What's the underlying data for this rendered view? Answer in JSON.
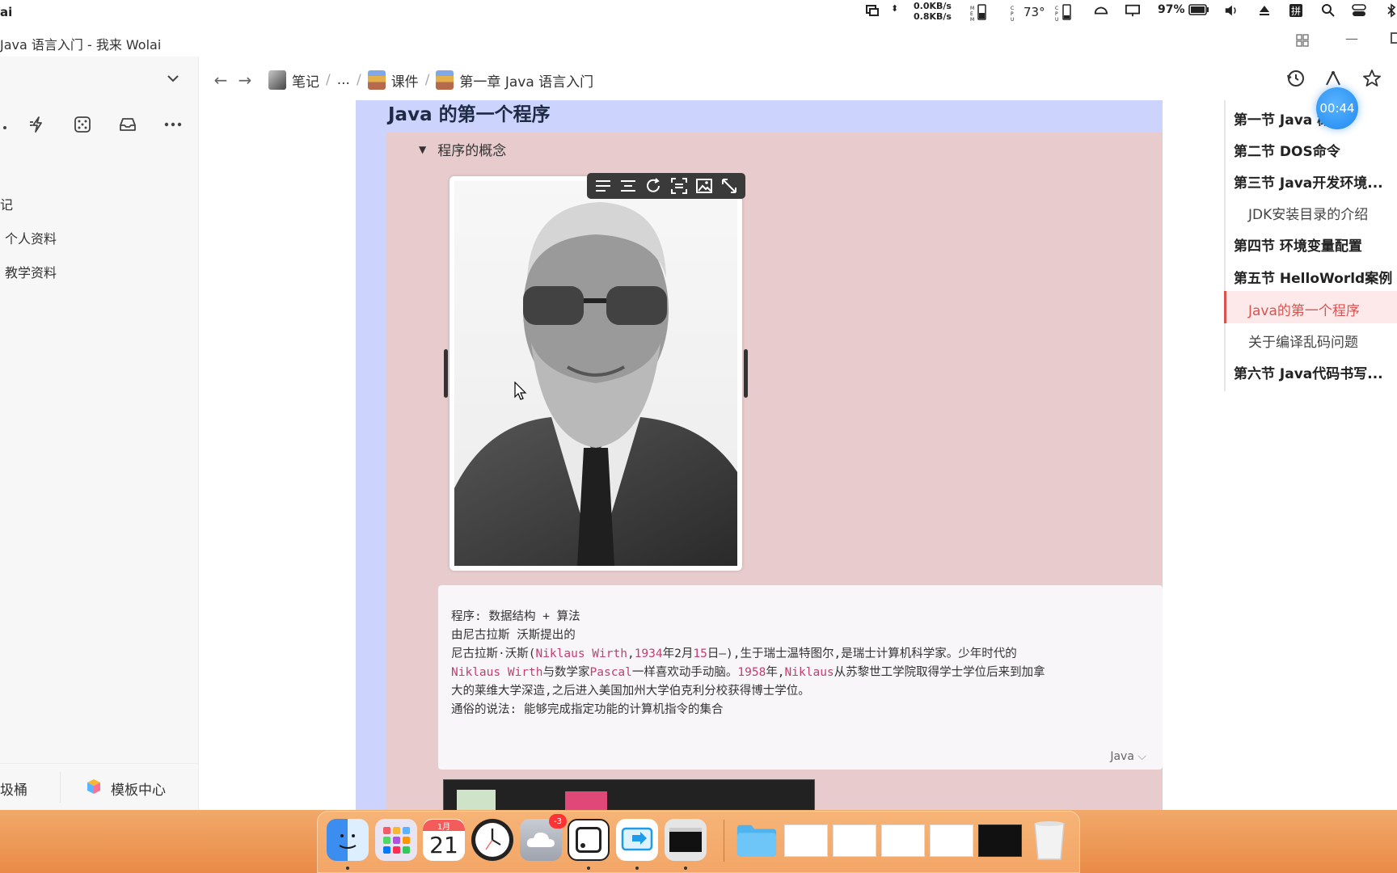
{
  "menubar": {
    "app_name": "ai",
    "net_up": "0.0KB/s",
    "net_down": "0.8KB/s",
    "temp": "73°",
    "battery": "97%"
  },
  "window": {
    "title": "Java 语言入门 - 我来 Wolai"
  },
  "sidebar": {
    "items": [
      {
        "label": "记"
      },
      {
        "label": "个人资料"
      },
      {
        "label": "教学资料"
      }
    ],
    "bottom_left": "圾桶",
    "bottom_right": "模板中心"
  },
  "breadcrumb": {
    "items": [
      "笔记",
      "...",
      "课件",
      "第一章 Java 语言入门"
    ]
  },
  "timer": "00:44",
  "doc": {
    "heading": "Java 的第一个程序",
    "toggle_label": "程序的概念",
    "code_lang": "Java",
    "code_lines": [
      "程序: 数据结构 + 算法",
      "由尼古拉斯 沃斯提出的",
      "尼古拉斯·沃斯(Niklaus Wirth,1934年2月15日—),生于瑞士温特图尔,是瑞士计算机科学家。少年时代的",
      "Niklaus Wirth与数学家Pascal一样喜欢动手动脑。1958年,Niklaus从苏黎世工学院取得学士学位后来到加拿",
      "大的莱维大学深造,之后进入美国加州大学伯克利分校获得博士学位。",
      "",
      "通俗的说法: 能够完成指定功能的计算机指令的集合"
    ]
  },
  "outline": {
    "items": [
      {
        "label": "第一节 Java 概述",
        "level": 2
      },
      {
        "label": "第二节 DOS命令",
        "level": 2
      },
      {
        "label": "第三节 Java开发环境...",
        "level": 2
      },
      {
        "label": "JDK安装目录的介绍",
        "level": 3
      },
      {
        "label": "第四节 环境变量配置",
        "level": 2
      },
      {
        "label": "第五节 HelloWorld案例",
        "level": 2
      },
      {
        "label": "Java的第一个程序",
        "level": 3,
        "active": true
      },
      {
        "label": "关于编译乱码问题",
        "level": 3
      },
      {
        "label": "第六节 Java代码书写...",
        "level": 2
      }
    ]
  },
  "dock": {
    "calendar_month": "1月",
    "calendar_day": "21",
    "badge": "-3"
  },
  "colors": {
    "accent_active": "#d9534f",
    "outer_block": "#ccd4fd",
    "inner_block": "#e7cbcd",
    "code_keyword": "#c13f72",
    "timer": "#1e88f0"
  }
}
